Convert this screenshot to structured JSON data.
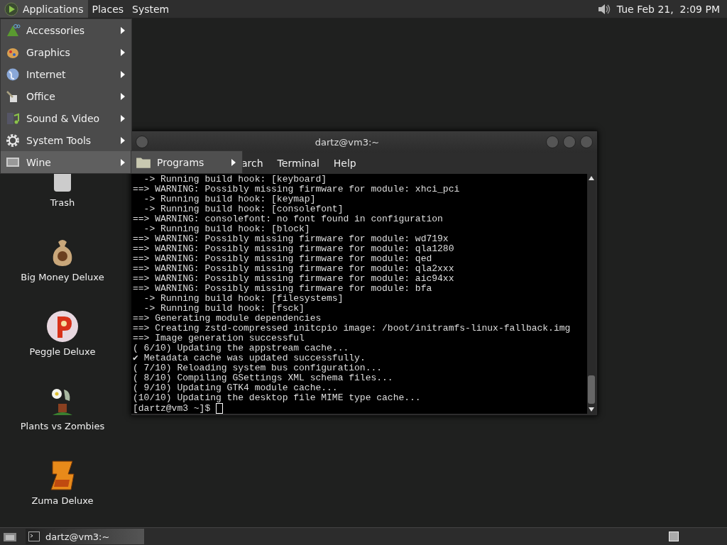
{
  "top_panel": {
    "menus": [
      {
        "label": "Applications",
        "selected": true
      },
      {
        "label": "Places",
        "selected": false
      },
      {
        "label": "System",
        "selected": false
      }
    ],
    "clock": "Tue Feb 21,  2:09 PM"
  },
  "applications_menu": {
    "items": [
      {
        "label": "Accessories",
        "kind": "accessories",
        "selected": false
      },
      {
        "label": "Graphics",
        "kind": "graphics",
        "selected": false
      },
      {
        "label": "Internet",
        "kind": "internet",
        "selected": false
      },
      {
        "label": "Office",
        "kind": "office",
        "selected": false
      },
      {
        "label": "Sound & Video",
        "kind": "media",
        "selected": false
      },
      {
        "label": "System Tools",
        "kind": "tools",
        "selected": false
      },
      {
        "label": "Wine",
        "kind": "wine",
        "selected": true
      }
    ],
    "submenu": {
      "items": [
        {
          "label": "Programs"
        }
      ]
    }
  },
  "desktop_icons": [
    {
      "label": "Trash",
      "kind": "trash"
    },
    {
      "label": "Big Money Deluxe",
      "kind": "money"
    },
    {
      "label": "Peggle Deluxe",
      "kind": "peggle"
    },
    {
      "label": "Plants vs Zombies",
      "kind": "plant"
    },
    {
      "label": "Zuma Deluxe",
      "kind": "zuma"
    }
  ],
  "terminal": {
    "title": "dartz@vm3:~",
    "menu": [
      "arch",
      "Terminal",
      "Help"
    ],
    "lines": [
      "  -> Running build hook: [keyboard]",
      "==> WARNING: Possibly missing firmware for module: xhci_pci",
      "  -> Running build hook: [keymap]",
      "  -> Running build hook: [consolefont]",
      "==> WARNING: consolefont: no font found in configuration",
      "  -> Running build hook: [block]",
      "==> WARNING: Possibly missing firmware for module: wd719x",
      "==> WARNING: Possibly missing firmware for module: qla1280",
      "==> WARNING: Possibly missing firmware for module: qed",
      "==> WARNING: Possibly missing firmware for module: qla2xxx",
      "==> WARNING: Possibly missing firmware for module: aic94xx",
      "==> WARNING: Possibly missing firmware for module: bfa",
      "  -> Running build hook: [filesystems]",
      "  -> Running build hook: [fsck]",
      "==> Generating module dependencies",
      "==> Creating zstd-compressed initcpio image: /boot/initramfs-linux-fallback.img",
      "==> Image generation successful",
      "( 6/10) Updating the appstream cache...",
      "✔ Metadata cache was updated successfully.",
      "( 7/10) Reloading system bus configuration...",
      "( 8/10) Compiling GSettings XML schema files...",
      "( 9/10) Updating GTK4 module cache...",
      "(10/10) Updating the desktop file MIME type cache..."
    ],
    "prompt": "[dartz@vm3 ~]$"
  },
  "taskbar": {
    "tasks": [
      {
        "label": "dartz@vm3:~",
        "selected": true
      }
    ]
  }
}
